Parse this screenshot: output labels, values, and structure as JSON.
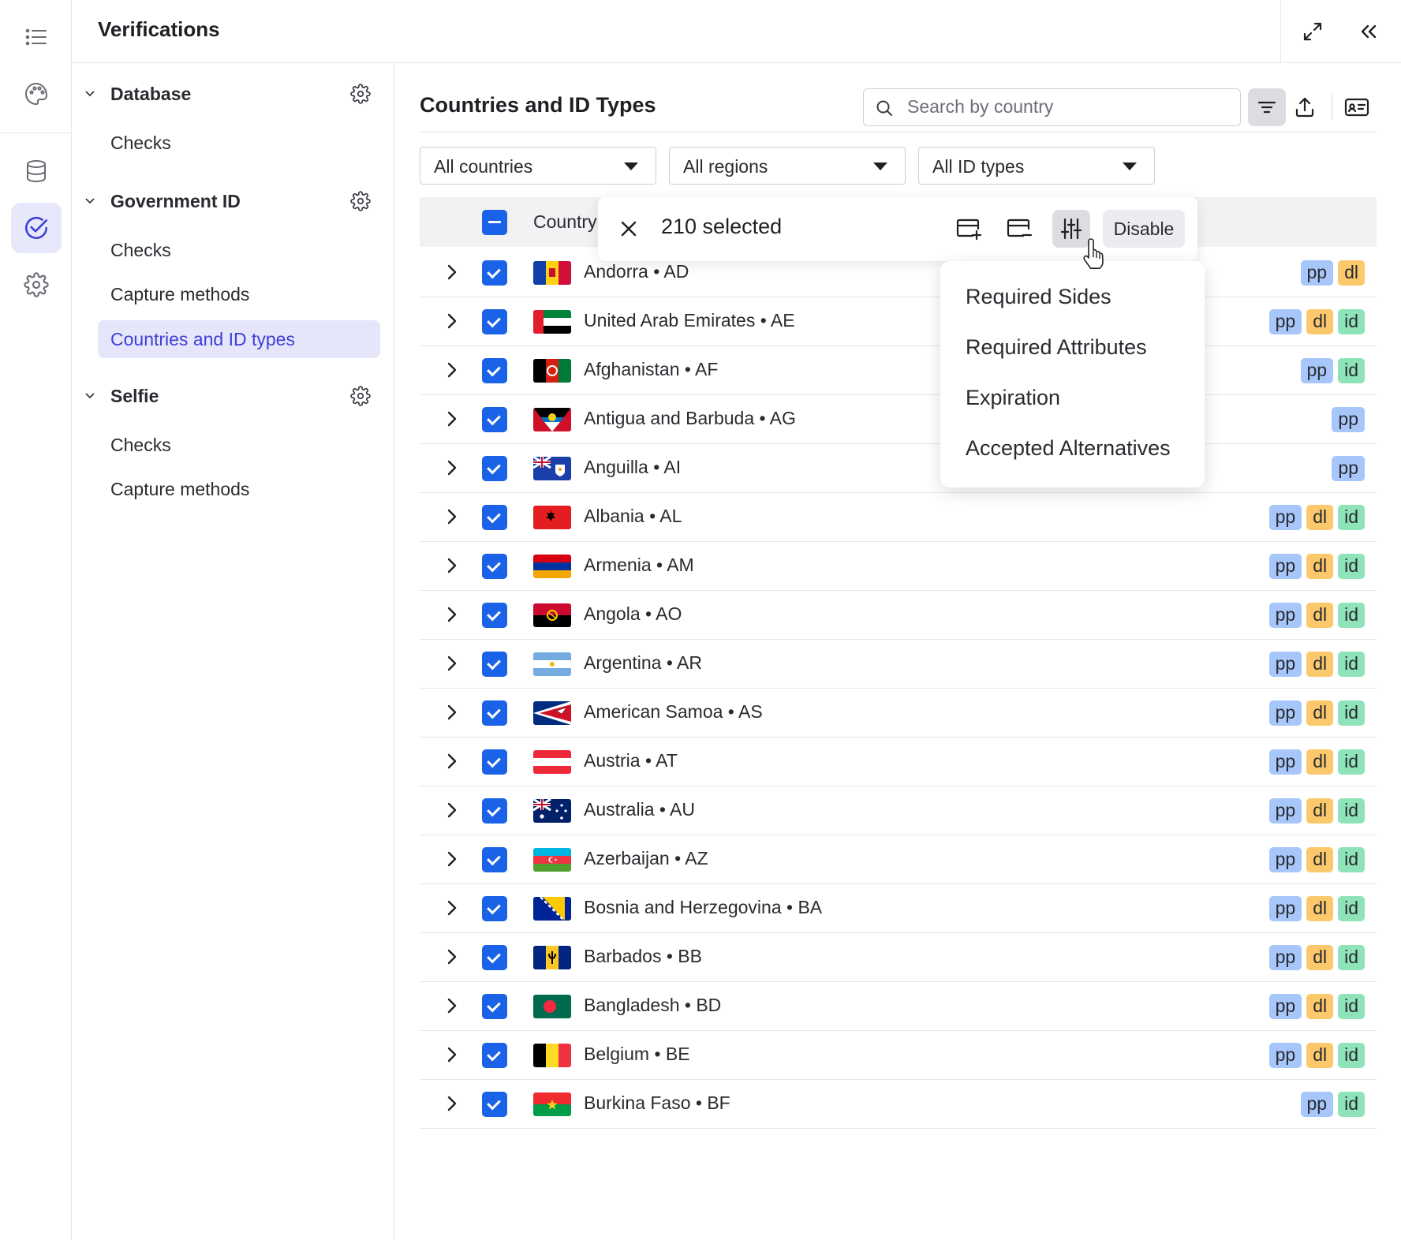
{
  "header": {
    "title": "Verifications"
  },
  "rail": {
    "icons": [
      "list-icon",
      "palette-icon",
      "database-icon",
      "check-circle-icon",
      "settings-icon"
    ],
    "active": "check-circle-icon"
  },
  "sidenav": {
    "sections": [
      {
        "title": "Database",
        "items": [
          "Checks"
        ]
      },
      {
        "title": "Government ID",
        "items": [
          "Checks",
          "Capture methods",
          "Countries and ID types"
        ]
      },
      {
        "title": "Selfie",
        "items": [
          "Checks",
          "Capture methods"
        ]
      }
    ],
    "active_item": "Countries and ID types"
  },
  "main": {
    "title": "Countries and ID Types",
    "search": {
      "placeholder": "Search by country",
      "value": ""
    },
    "filters": [
      {
        "label": "All countries"
      },
      {
        "label": "All regions"
      },
      {
        "label": "All ID types"
      }
    ]
  },
  "table": {
    "header_country": "Country",
    "rows": [
      {
        "name": "Andorra • AD",
        "flag": "AD",
        "types": [
          "pp",
          "dl"
        ]
      },
      {
        "name": "United Arab Emirates • AE",
        "flag": "AE",
        "types": [
          "pp",
          "dl",
          "id"
        ]
      },
      {
        "name": "Afghanistan • AF",
        "flag": "AF",
        "types": [
          "pp",
          "id"
        ]
      },
      {
        "name": "Antigua and Barbuda • AG",
        "flag": "AG",
        "types": [
          "pp"
        ]
      },
      {
        "name": "Anguilla • AI",
        "flag": "AI",
        "types": [
          "pp"
        ]
      },
      {
        "name": "Albania • AL",
        "flag": "AL",
        "types": [
          "pp",
          "dl",
          "id"
        ]
      },
      {
        "name": "Armenia • AM",
        "flag": "AM",
        "types": [
          "pp",
          "dl",
          "id"
        ]
      },
      {
        "name": "Angola • AO",
        "flag": "AO",
        "types": [
          "pp",
          "dl",
          "id"
        ]
      },
      {
        "name": "Argentina • AR",
        "flag": "AR",
        "types": [
          "pp",
          "dl",
          "id"
        ]
      },
      {
        "name": "American Samoa • AS",
        "flag": "AS",
        "types": [
          "pp",
          "dl",
          "id"
        ]
      },
      {
        "name": "Austria • AT",
        "flag": "AT",
        "types": [
          "pp",
          "dl",
          "id"
        ]
      },
      {
        "name": "Australia • AU",
        "flag": "AU",
        "types": [
          "pp",
          "dl",
          "id"
        ]
      },
      {
        "name": "Azerbaijan • AZ",
        "flag": "AZ",
        "types": [
          "pp",
          "dl",
          "id"
        ]
      },
      {
        "name": "Bosnia and Herzegovina • BA",
        "flag": "BA",
        "types": [
          "pp",
          "dl",
          "id"
        ]
      },
      {
        "name": "Barbados • BB",
        "flag": "BB",
        "types": [
          "pp",
          "dl",
          "id"
        ]
      },
      {
        "name": "Bangladesh • BD",
        "flag": "BD",
        "types": [
          "pp",
          "dl",
          "id"
        ]
      },
      {
        "name": "Belgium • BE",
        "flag": "BE",
        "types": [
          "pp",
          "dl",
          "id"
        ]
      },
      {
        "name": "Burkina Faso • BF",
        "flag": "BF",
        "types": [
          "pp",
          "id"
        ]
      }
    ]
  },
  "selection_toolbar": {
    "count_label": "210 selected",
    "disable_label": "Disable",
    "actions": [
      "add-card-icon",
      "remove-card-icon",
      "sliders-icon"
    ]
  },
  "menu": {
    "items": [
      "Required Sides",
      "Required Attributes",
      "Expiration",
      "Accepted Alternatives"
    ]
  },
  "colors": {
    "accent": "#1a63e8",
    "nav_active_bg": "#e6e6fb",
    "nav_active_text": "#3b3fd6",
    "pp": "#a7c7fb",
    "dl": "#fbc96b",
    "id": "#8ee4b8"
  }
}
